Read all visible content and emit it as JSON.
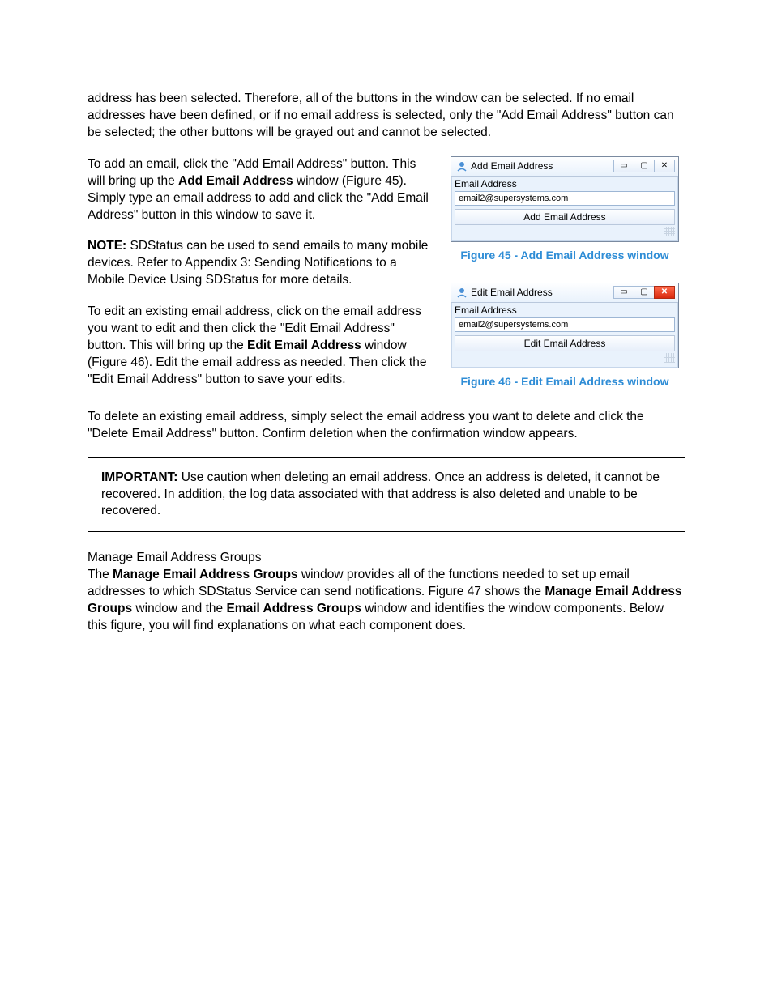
{
  "paragraphs": {
    "p0": "address has been selected. Therefore, all of the buttons in the window can be selected. If no email addresses have been defined, or if no email address is selected, only the \"Add Email Address\" button can be selected; the other buttons will be grayed out and cannot be selected.",
    "p1a": "To add an email, click the \"Add Email Address\" button. This will bring up the ",
    "p1b": "Add Email Address",
    "p1c": " window (Figure 45). Simply type an email address to add and click the \"Add Email Address\" button in this window to save it.",
    "p2a": "NOTE:",
    "p2b": " SDStatus can be used to send emails to many mobile devices. Refer to Appendix 3: Sending Notifications to a Mobile Device Using SDStatus for more details.",
    "p3a": "To edit an existing email address, click on the email address you want to edit and then click the \"Edit Email Address\" button. This will bring up the ",
    "p3b": "Edit Email Address",
    "p3c": " window (Figure 46). Edit the email address as needed. Then click the \"Edit Email Address\" button to save your edits.",
    "p4": "To delete an existing email address, simply select the email address you want to delete and click the \"Delete Email Address\" button. Confirm deletion when the confirmation window appears.",
    "p5a": "IMPORTANT:",
    "p5b": " Use caution when deleting an email address. Once an address is deleted, it cannot be recovered. In addition, the log data associated with that address is also deleted and unable to be recovered.",
    "p6": "Manage Email Address Groups",
    "p7a": "The ",
    "p7b": "Manage Email Address Groups",
    "p7c": " window provides all of the functions needed to set up email addresses to which SDStatus Service can send notifications. Figure 47 shows the ",
    "p7d": "Manage Email Address Groups",
    "p7e": " window and the ",
    "p7f": "Email Address Groups",
    "p7g": " window and identifies the window components. Below this figure, you will find explanations on what each component does."
  },
  "fig45": {
    "title": "Add Email Address",
    "label": "Email Address",
    "value": "email2@supersystems.com",
    "button": "Add Email Address",
    "caption": "Figure 45 - Add Email Address window",
    "close_glyph": "✕",
    "min_glyph": "▭",
    "max_glyph": "▢"
  },
  "fig46": {
    "title": "Edit Email Address",
    "label": "Email Address",
    "value": "email2@supersystems.com",
    "button": "Edit Email Address",
    "caption": "Figure 46 - Edit Email Address window",
    "close_glyph": "✕",
    "min_glyph": "▭",
    "max_glyph": "▢"
  }
}
